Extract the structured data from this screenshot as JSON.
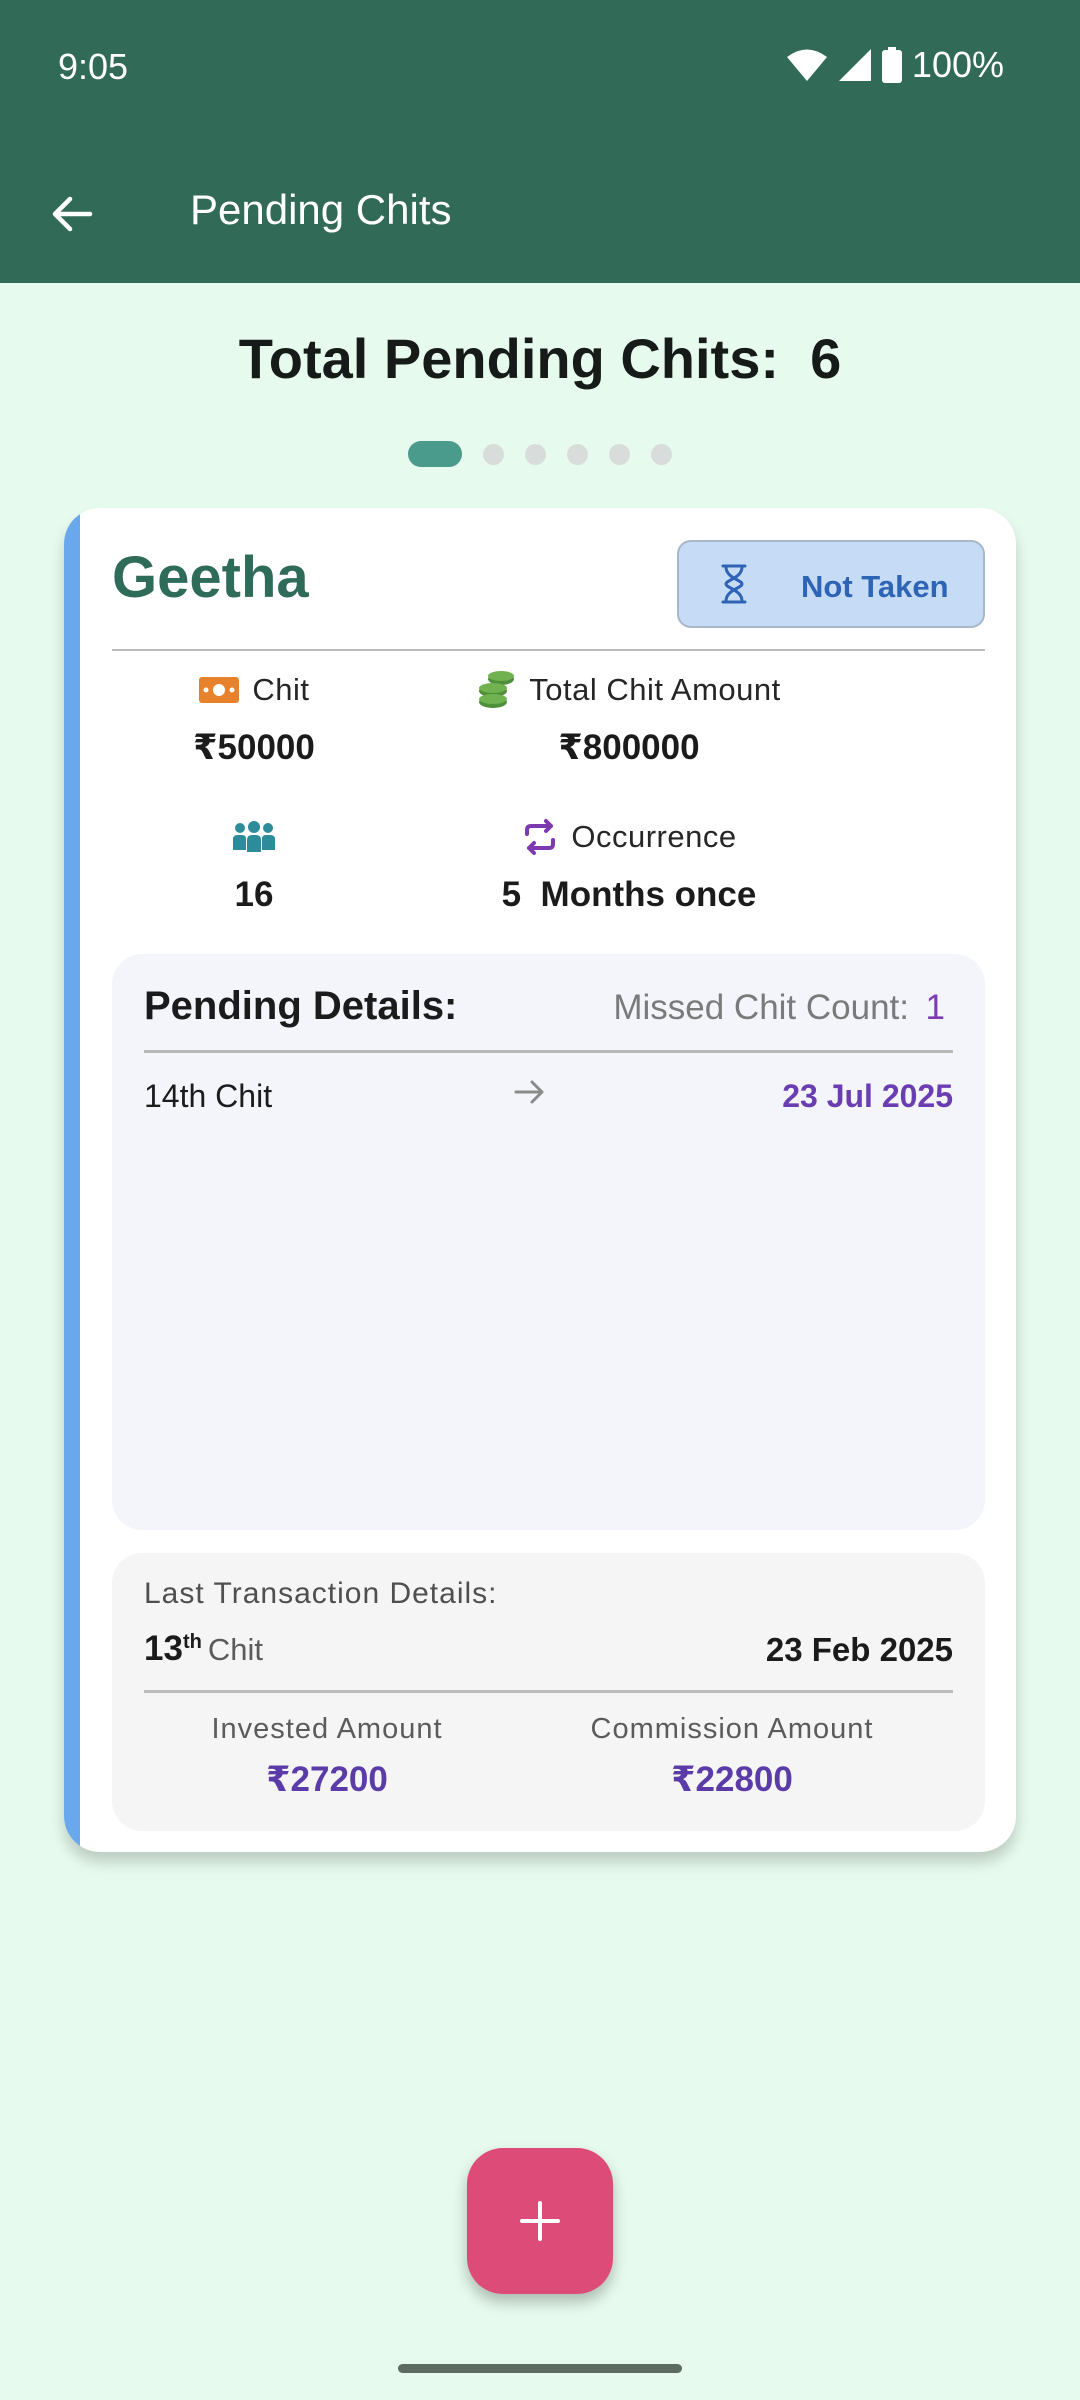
{
  "status_bar": {
    "time": "9:05",
    "battery": "100%"
  },
  "app_bar": {
    "title": "Pending Chits",
    "back_icon": "arrow-back-icon"
  },
  "summary": {
    "total_label": "Total Pending Chits:  6",
    "page_count": 6,
    "active_page": 1
  },
  "card": {
    "name": "Geetha",
    "status": "Not Taken",
    "status_icon": "hourglass-icon",
    "chit_label": "Chit",
    "chit_value": "₹50000",
    "total_label": "Total Chit Amount",
    "total_value": "₹800000",
    "members_value": "16",
    "occurrence_label": "Occurrence",
    "occurrence_value": "5  Months once",
    "pending": {
      "title": "Pending Details:",
      "missed_label": "Missed Chit Count:",
      "missed_count": "1",
      "items": [
        {
          "chit": "14th Chit",
          "date": "23 Jul 2025"
        }
      ]
    },
    "last_transaction": {
      "title": "Last Transaction Details:",
      "chit_number": "13",
      "chit_suffix": "th",
      "chit_word": "Chit",
      "date": "23 Feb 2025",
      "invested_label": "Invested Amount",
      "invested_value": "₹27200",
      "commission_label": "Commission Amount",
      "commission_value": "₹22800"
    }
  },
  "fab": {
    "icon": "plus-icon"
  },
  "colors": {
    "app_bar": "#316a57",
    "background": "#e6faed",
    "accent_stripe": "#6aa8ee",
    "fab": "#dd4b78",
    "date_purple": "#6a3db3"
  }
}
